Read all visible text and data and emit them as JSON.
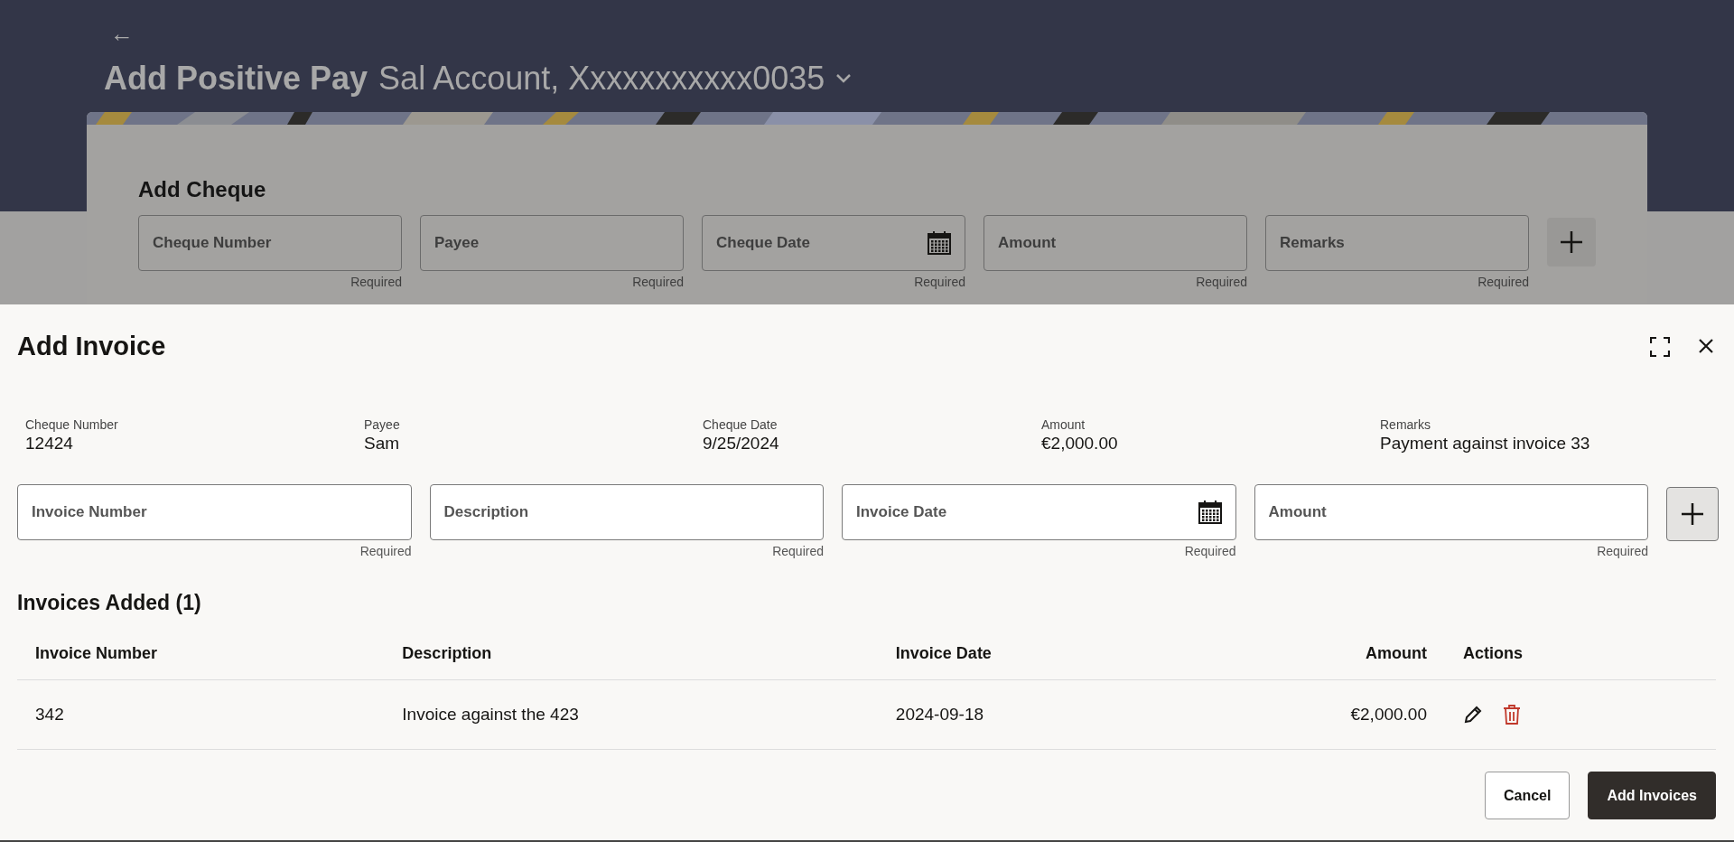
{
  "page": {
    "back": "←",
    "title": "Add Positive Pay",
    "account": "Sal Account, Xxxxxxxxxxx0035"
  },
  "cheque_form": {
    "title": "Add Cheque",
    "fields": [
      {
        "kind": "text",
        "placeholder": "Cheque Number",
        "hint": "Required"
      },
      {
        "kind": "text",
        "placeholder": "Payee",
        "hint": "Required"
      },
      {
        "kind": "date",
        "placeholder": "Cheque Date",
        "hint": "Required"
      },
      {
        "kind": "text",
        "placeholder": "Amount",
        "hint": "Required"
      },
      {
        "kind": "text",
        "placeholder": "Remarks",
        "hint": "Required"
      }
    ]
  },
  "dialog": {
    "title": "Add Invoice",
    "summary": [
      {
        "label": "Cheque Number",
        "value": "12424"
      },
      {
        "label": "Payee",
        "value": "Sam"
      },
      {
        "label": "Cheque Date",
        "value": "9/25/2024"
      },
      {
        "label": "Amount",
        "value": "€2,000.00"
      },
      {
        "label": "Remarks",
        "value": "Payment against invoice 33"
      }
    ],
    "fields": [
      {
        "kind": "text",
        "placeholder": "Invoice Number",
        "hint": "Required"
      },
      {
        "kind": "text",
        "placeholder": "Description",
        "hint": "Required"
      },
      {
        "kind": "date",
        "placeholder": "Invoice Date",
        "hint": "Required"
      },
      {
        "kind": "text",
        "placeholder": "Amount",
        "hint": "Required"
      }
    ],
    "table": {
      "title": "Invoices Added (1)",
      "columns": [
        {
          "label": "Invoice Number",
          "numeric": false
        },
        {
          "label": "Description",
          "numeric": false
        },
        {
          "label": "Invoice Date",
          "numeric": false
        },
        {
          "label": "Amount",
          "numeric": true
        },
        {
          "label": "Actions",
          "numeric": false
        }
      ],
      "rows": [
        {
          "cells": [
            "342",
            "Invoice against the 423",
            "2024-09-18",
            "€2,000.00"
          ]
        }
      ]
    },
    "buttons": [
      {
        "kind": "secondary",
        "label": "Cancel"
      },
      {
        "kind": "primary",
        "label": "Add Invoices"
      }
    ]
  }
}
